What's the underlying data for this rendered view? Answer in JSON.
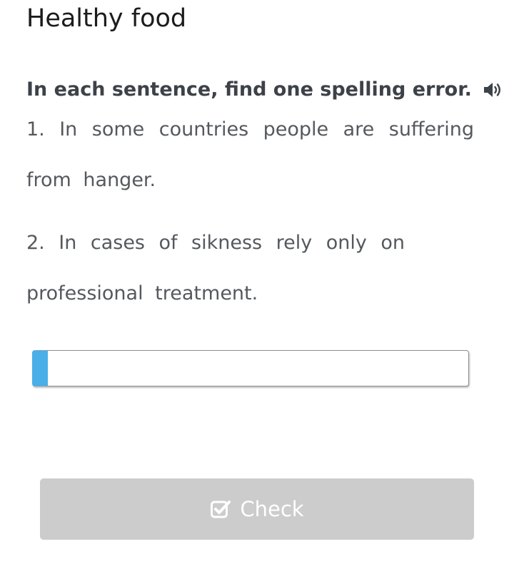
{
  "page": {
    "title": "Healthy food"
  },
  "exercise": {
    "instruction": "In each sentence, find one spelling error.",
    "sentences": [
      {
        "line1": "1. In some countries people are suffering",
        "line2": "from hanger."
      },
      {
        "line1": "2. In cases of sikness rely only on",
        "line2": "professional treatment."
      }
    ],
    "answer": {
      "value": "",
      "placeholder": ""
    },
    "check_button": {
      "label": "Check",
      "icon": "checkbox-check-icon",
      "state": "disabled"
    },
    "audio_icon": "speaker-icon"
  },
  "colors": {
    "accent": "#4aaee8",
    "button_disabled": "#cccccc",
    "title_text": "#1c1c1c",
    "body_text": "#55595e"
  }
}
